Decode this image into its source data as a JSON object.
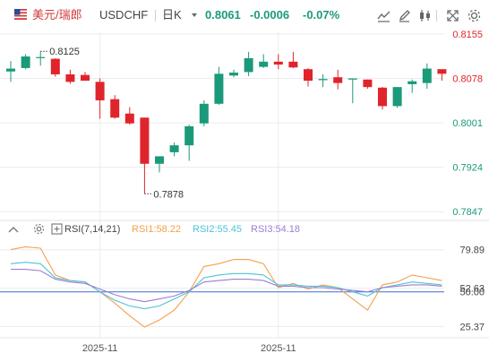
{
  "header": {
    "symbol_cn": "美元/瑞郎",
    "symbol_code": "USDCHF",
    "period": "日K",
    "price": "0.8061",
    "change": "-0.0006",
    "change_pct": "-0.07%",
    "flag_icon": "us-flag-icon",
    "tools": [
      "line-chart-icon",
      "draw-pen-icon",
      "candlestick-type-icon",
      "fullscreen-icon",
      "settings-icon"
    ]
  },
  "colors": {
    "up": "#1a9a7a",
    "down": "#e0242b",
    "rsi1": "#f5a04a",
    "rsi2": "#4cc3d9",
    "rsi3": "#9b7fd0",
    "rsi50": "#3a6fd8",
    "grid": "#ececec"
  },
  "rsi_legend": {
    "label": "RSI(7,14,21)",
    "rsi1": "RSI1:58.22",
    "rsi2": "RSI2:55.45",
    "rsi3": "RSI3:54.18",
    "eye_icon": "eye-icon",
    "settings_icon": "settings-icon",
    "more_icon": "more-icon"
  },
  "chart_data": [
    {
      "type": "candlestick",
      "title": "",
      "ylim": [
        0.7838,
        0.8158
      ],
      "y_ticks": [
        {
          "value": 0.8155,
          "label": "0.8155",
          "color": "#e0242b"
        },
        {
          "value": 0.8078,
          "label": "0.8078",
          "color": "#e0242b"
        },
        {
          "value": 0.8001,
          "label": "0.8001",
          "color": "#1a9a7a"
        },
        {
          "value": 0.7924,
          "label": "0.7924",
          "color": "#1a9a7a"
        },
        {
          "value": 0.7847,
          "label": "0.7847",
          "color": "#1a9a7a"
        }
      ],
      "annotations": [
        {
          "label": "0.8125",
          "value": 0.8125,
          "candle": 2
        },
        {
          "label": "0.7878",
          "value": 0.7878,
          "candle": 9
        }
      ],
      "x_labels": [
        {
          "label": "2025-11",
          "candle": 6
        },
        {
          "label": "2025-11",
          "candle": 18
        }
      ],
      "candles": [
        {
          "o": 0.809,
          "h": 0.8108,
          "l": 0.8072,
          "c": 0.8095
        },
        {
          "o": 0.8096,
          "h": 0.812,
          "l": 0.8094,
          "c": 0.8116
        },
        {
          "o": 0.8115,
          "h": 0.8125,
          "l": 0.81,
          "c": 0.8115
        },
        {
          "o": 0.8112,
          "h": 0.8113,
          "l": 0.8081,
          "c": 0.8085
        },
        {
          "o": 0.8085,
          "h": 0.8093,
          "l": 0.8069,
          "c": 0.8072
        },
        {
          "o": 0.8084,
          "h": 0.8089,
          "l": 0.8077,
          "c": 0.8074
        },
        {
          "o": 0.8072,
          "h": 0.8078,
          "l": 0.8008,
          "c": 0.804
        },
        {
          "o": 0.8042,
          "h": 0.8049,
          "l": 0.8008,
          "c": 0.801
        },
        {
          "o": 0.8017,
          "h": 0.8028,
          "l": 0.7998,
          "c": 0.8
        },
        {
          "o": 0.801,
          "h": 0.801,
          "l": 0.7878,
          "c": 0.793
        },
        {
          "o": 0.793,
          "h": 0.7942,
          "l": 0.7915,
          "c": 0.7943
        },
        {
          "o": 0.795,
          "h": 0.7967,
          "l": 0.7943,
          "c": 0.7962
        },
        {
          "o": 0.7962,
          "h": 0.7998,
          "l": 0.7935,
          "c": 0.7995
        },
        {
          "o": 0.8,
          "h": 0.804,
          "l": 0.7995,
          "c": 0.8034
        },
        {
          "o": 0.8034,
          "h": 0.8098,
          "l": 0.8032,
          "c": 0.8086
        },
        {
          "o": 0.8083,
          "h": 0.8093,
          "l": 0.808,
          "c": 0.8088
        },
        {
          "o": 0.8089,
          "h": 0.8124,
          "l": 0.8082,
          "c": 0.8113
        },
        {
          "o": 0.8098,
          "h": 0.812,
          "l": 0.8096,
          "c": 0.8107
        },
        {
          "o": 0.8107,
          "h": 0.812,
          "l": 0.8094,
          "c": 0.8102
        },
        {
          "o": 0.8107,
          "h": 0.8124,
          "l": 0.8096,
          "c": 0.8097
        },
        {
          "o": 0.8094,
          "h": 0.8096,
          "l": 0.8064,
          "c": 0.8074
        },
        {
          "o": 0.8075,
          "h": 0.8085,
          "l": 0.8063,
          "c": 0.8077
        },
        {
          "o": 0.808,
          "h": 0.8093,
          "l": 0.8059,
          "c": 0.807
        },
        {
          "o": 0.8076,
          "h": 0.8078,
          "l": 0.8035,
          "c": 0.8078
        },
        {
          "o": 0.8076,
          "h": 0.8076,
          "l": 0.806,
          "c": 0.8063
        },
        {
          "o": 0.8062,
          "h": 0.8063,
          "l": 0.8024,
          "c": 0.803
        },
        {
          "o": 0.803,
          "h": 0.8063,
          "l": 0.8027,
          "c": 0.8063
        },
        {
          "o": 0.8068,
          "h": 0.8076,
          "l": 0.8053,
          "c": 0.8073
        },
        {
          "o": 0.807,
          "h": 0.8104,
          "l": 0.806,
          "c": 0.8095
        },
        {
          "o": 0.8094,
          "h": 0.8093,
          "l": 0.8074,
          "c": 0.8086
        }
      ]
    },
    {
      "type": "line",
      "title": "RSI(7,14,21)",
      "ylim": [
        18,
        88
      ],
      "y_ticks": [
        {
          "value": 79.89,
          "label": "79.89"
        },
        {
          "value": 52.63,
          "label": "52.63"
        },
        {
          "value": 50.0,
          "label": "50.00"
        },
        {
          "value": 25.37,
          "label": "25.37"
        }
      ],
      "reference_line": 50,
      "series": [
        {
          "name": "RSI1",
          "values": [
            80,
            82,
            81,
            62,
            58,
            57,
            50,
            42,
            33,
            25,
            30,
            37,
            50,
            68,
            70,
            73,
            73,
            70,
            53,
            56,
            52,
            55,
            53,
            45,
            37,
            55,
            57,
            62,
            60,
            58
          ]
        },
        {
          "name": "RSI2",
          "values": [
            70,
            71,
            70,
            60,
            58,
            57,
            50,
            44,
            40,
            38,
            40,
            45,
            50,
            60,
            62,
            63,
            63,
            62,
            55,
            55,
            54,
            54,
            53,
            50,
            47,
            53,
            55,
            57,
            56,
            55
          ]
        },
        {
          "name": "RSI3",
          "values": [
            66,
            66,
            65,
            59,
            57,
            56,
            52,
            48,
            45,
            43,
            45,
            47,
            51,
            57,
            58,
            59,
            59,
            58,
            54,
            54,
            53,
            53,
            52,
            51,
            50,
            53,
            54,
            55,
            55,
            54
          ]
        }
      ]
    }
  ]
}
